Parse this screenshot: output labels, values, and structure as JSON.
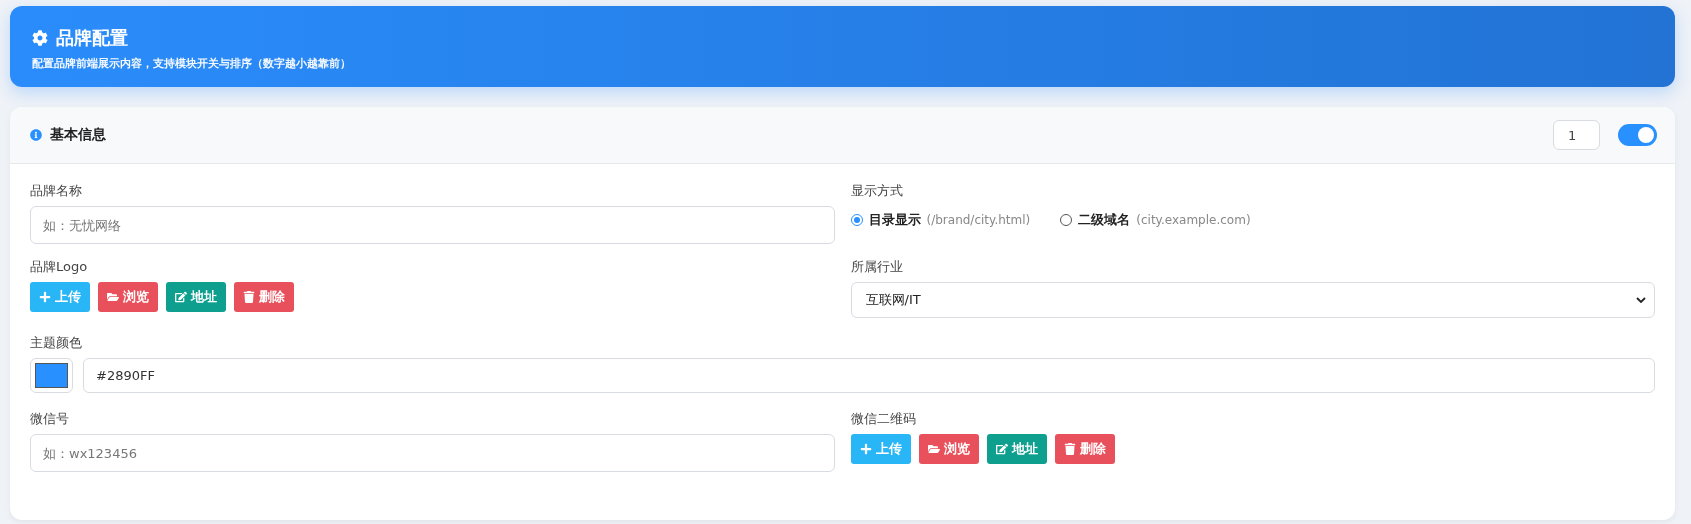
{
  "header": {
    "title": "品牌配置",
    "subtitle": "配置品牌前端展示内容，支持模块开关与排序（数字越小越靠前）"
  },
  "section": {
    "title": "基本信息",
    "order": "1",
    "enabled": true,
    "fields": [
      {
        "kind": "text",
        "label": "品牌名称",
        "placeholder": "如：无忧网络"
      },
      {
        "kind": "radio",
        "label": "显示方式",
        "options": [
          {
            "label": "目录显示",
            "hint": "(/brand/city.html)",
            "selected": true
          },
          {
            "label": "二级域名",
            "hint": "(city.example.com)",
            "selected": false
          }
        ]
      },
      {
        "kind": "image",
        "label": "品牌Logo",
        "buttons": [
          {
            "kind": "upload",
            "label": "上传"
          },
          {
            "kind": "browse",
            "label": "浏览"
          },
          {
            "kind": "url",
            "label": "地址"
          },
          {
            "kind": "delete",
            "label": "删除"
          }
        ]
      },
      {
        "kind": "select",
        "label": "所属行业",
        "value": "互联网/IT"
      },
      {
        "kind": "color",
        "label": "主题颜色",
        "value": "#2890FF"
      },
      {
        "kind": "text",
        "label": "微信号",
        "placeholder": "如：wx123456"
      },
      {
        "kind": "image",
        "label": "微信二维码",
        "buttons": [
          {
            "kind": "upload",
            "label": "上传"
          },
          {
            "kind": "browse",
            "label": "浏览"
          },
          {
            "kind": "url",
            "label": "地址"
          },
          {
            "kind": "delete",
            "label": "删除"
          }
        ]
      }
    ]
  }
}
